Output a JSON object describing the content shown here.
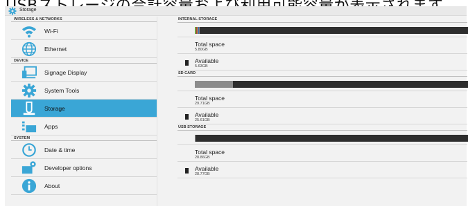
{
  "caption": "USBストレージの合計容量および利用可能容量が表示されます。",
  "actionbar": {
    "title": "Storage",
    "icon": "gear-icon"
  },
  "sidebar": {
    "sections": [
      {
        "header": "WIRELESS & NETWORKS",
        "items": [
          {
            "label": "Wi-Fi",
            "icon": "wifi-icon"
          },
          {
            "label": "Ethernet",
            "icon": "globe-icon"
          }
        ]
      },
      {
        "header": "DEVICE",
        "items": [
          {
            "label": "Signage Display",
            "icon": "monitor-icon"
          },
          {
            "label": "System Tools",
            "icon": "gear-icon"
          },
          {
            "label": "Storage",
            "icon": "storage-icon",
            "selected": true
          },
          {
            "label": "Apps",
            "icon": "apps-icon"
          }
        ]
      },
      {
        "header": "SYSTEM",
        "items": [
          {
            "label": "Date & time",
            "icon": "clock-icon"
          },
          {
            "label": "Developer options",
            "icon": "developer-icon"
          },
          {
            "label": "About",
            "icon": "info-icon"
          }
        ]
      }
    ]
  },
  "storage": [
    {
      "header": "INTERNAL STORAGE",
      "usage_segments": [
        {
          "fraction": 0.004,
          "color": "#6fa33c"
        },
        {
          "fraction": 0.003,
          "color": "#b0413e"
        },
        {
          "fraction": 0.003,
          "color": "#c98a2b"
        },
        {
          "fraction": 0.004,
          "color": "#4a6fb5"
        },
        {
          "fraction": 0.004,
          "color": "#8a8a8a"
        }
      ],
      "total_label": "Total space",
      "total_value": "5.80GB",
      "available_label": "Available",
      "available_value": "5.63GB"
    },
    {
      "header": "SD CARD",
      "usage_segments": [
        {
          "fraction": 0.138,
          "color": "#8c8c8c"
        }
      ],
      "total_label": "Total space",
      "total_value": "29.71GB",
      "available_label": "Available",
      "available_value": "25.61GB"
    },
    {
      "header": "USB STORAGE",
      "usage_segments": [
        {
          "fraction": 0.003,
          "color": "#8c8c8c"
        }
      ],
      "total_label": "Total space",
      "total_value": "28.86GB",
      "available_label": "Available",
      "available_value": "28.77GB"
    }
  ],
  "colors": {
    "selected_bg": "#3aa6d6",
    "bar_bg": "#2e2e2e",
    "icon_blue": "#3aa6d6"
  }
}
